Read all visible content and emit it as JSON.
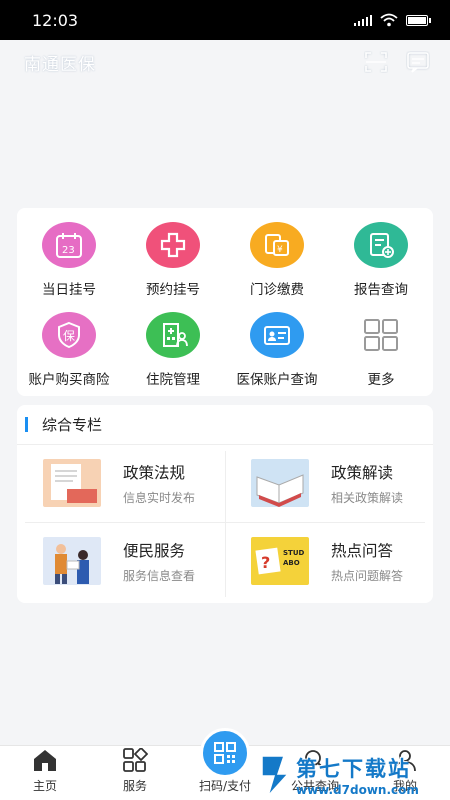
{
  "status": {
    "time": "12:03"
  },
  "header": {
    "title": "南通医保"
  },
  "services": [
    {
      "label": "当日挂号",
      "icon": "calendar-icon",
      "color": "#e66cc4"
    },
    {
      "label": "预约挂号",
      "icon": "medical-cross-icon",
      "color": "#f0517a"
    },
    {
      "label": "门诊缴费",
      "icon": "payment-icon",
      "color": "#f8ab21"
    },
    {
      "label": "报告查询",
      "icon": "report-icon",
      "color": "#2fb996"
    },
    {
      "label": "账户购买商险",
      "icon": "insurance-shield-icon",
      "color": "#e670c4"
    },
    {
      "label": "住院管理",
      "icon": "hospital-icon",
      "color": "#3dbf55"
    },
    {
      "label": "医保账户查询",
      "icon": "id-card-icon",
      "color": "#2f9bf0"
    },
    {
      "label": "更多",
      "icon": "more-grid-icon",
      "color": "#9a9a9a"
    }
  ],
  "column": {
    "title": "综合专栏",
    "items": [
      {
        "title": "政策法规",
        "subtitle": "信息实时发布"
      },
      {
        "title": "政策解读",
        "subtitle": "相关政策解读"
      },
      {
        "title": "便民服务",
        "subtitle": "服务信息查看"
      },
      {
        "title": "热点问答",
        "subtitle": "热点问题解答"
      }
    ]
  },
  "tabs": [
    {
      "label": "主页",
      "icon": "home-icon"
    },
    {
      "label": "服务",
      "icon": "services-grid-icon"
    },
    {
      "label": "扫码/支付",
      "icon": "qr-code-icon"
    },
    {
      "label": "公共查询",
      "icon": "search-icon"
    },
    {
      "label": "我的",
      "icon": "profile-icon"
    }
  ],
  "watermark": {
    "name": "第七下载站",
    "url": "www.d7down.com"
  }
}
